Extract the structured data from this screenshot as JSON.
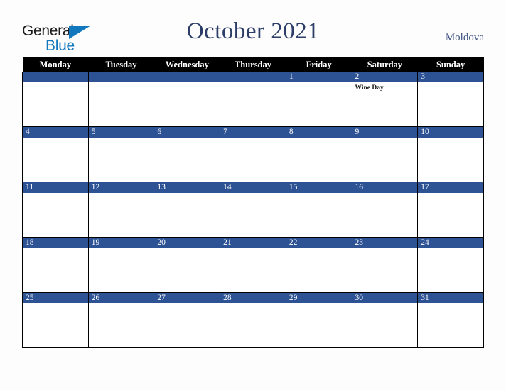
{
  "brand": {
    "line1": "General",
    "line2": "Blue",
    "triangle_color": "#1278be",
    "text_color": "#1a1a1a"
  },
  "header": {
    "month_title": "October 2021",
    "locale": "Moldova",
    "title_color": "#2c3e67",
    "locale_color": "#3b5180"
  },
  "calendar": {
    "weekday_headers": [
      "Monday",
      "Tuesday",
      "Wednesday",
      "Thursday",
      "Friday",
      "Saturday",
      "Sunday"
    ],
    "header_bg": "#000000",
    "header_fg": "#ffffff",
    "date_bar_bg": "#2e5395",
    "date_bar_fg": "#ffffff",
    "cell_bg": "#ffffff",
    "grid_line": "#000000",
    "weeks": [
      {
        "days": [
          {
            "date": "",
            "events": []
          },
          {
            "date": "",
            "events": []
          },
          {
            "date": "",
            "events": []
          },
          {
            "date": "",
            "events": []
          },
          {
            "date": "1",
            "events": []
          },
          {
            "date": "2",
            "events": [
              "Wine Day"
            ]
          },
          {
            "date": "3",
            "events": []
          }
        ]
      },
      {
        "days": [
          {
            "date": "4",
            "events": []
          },
          {
            "date": "5",
            "events": []
          },
          {
            "date": "6",
            "events": []
          },
          {
            "date": "7",
            "events": []
          },
          {
            "date": "8",
            "events": []
          },
          {
            "date": "9",
            "events": []
          },
          {
            "date": "10",
            "events": []
          }
        ]
      },
      {
        "days": [
          {
            "date": "11",
            "events": []
          },
          {
            "date": "12",
            "events": []
          },
          {
            "date": "13",
            "events": []
          },
          {
            "date": "14",
            "events": []
          },
          {
            "date": "15",
            "events": []
          },
          {
            "date": "16",
            "events": []
          },
          {
            "date": "17",
            "events": []
          }
        ]
      },
      {
        "days": [
          {
            "date": "18",
            "events": []
          },
          {
            "date": "19",
            "events": []
          },
          {
            "date": "20",
            "events": []
          },
          {
            "date": "21",
            "events": []
          },
          {
            "date": "22",
            "events": []
          },
          {
            "date": "23",
            "events": []
          },
          {
            "date": "24",
            "events": []
          }
        ]
      },
      {
        "days": [
          {
            "date": "25",
            "events": []
          },
          {
            "date": "26",
            "events": []
          },
          {
            "date": "27",
            "events": []
          },
          {
            "date": "28",
            "events": []
          },
          {
            "date": "29",
            "events": []
          },
          {
            "date": "30",
            "events": []
          },
          {
            "date": "31",
            "events": []
          }
        ]
      }
    ]
  }
}
